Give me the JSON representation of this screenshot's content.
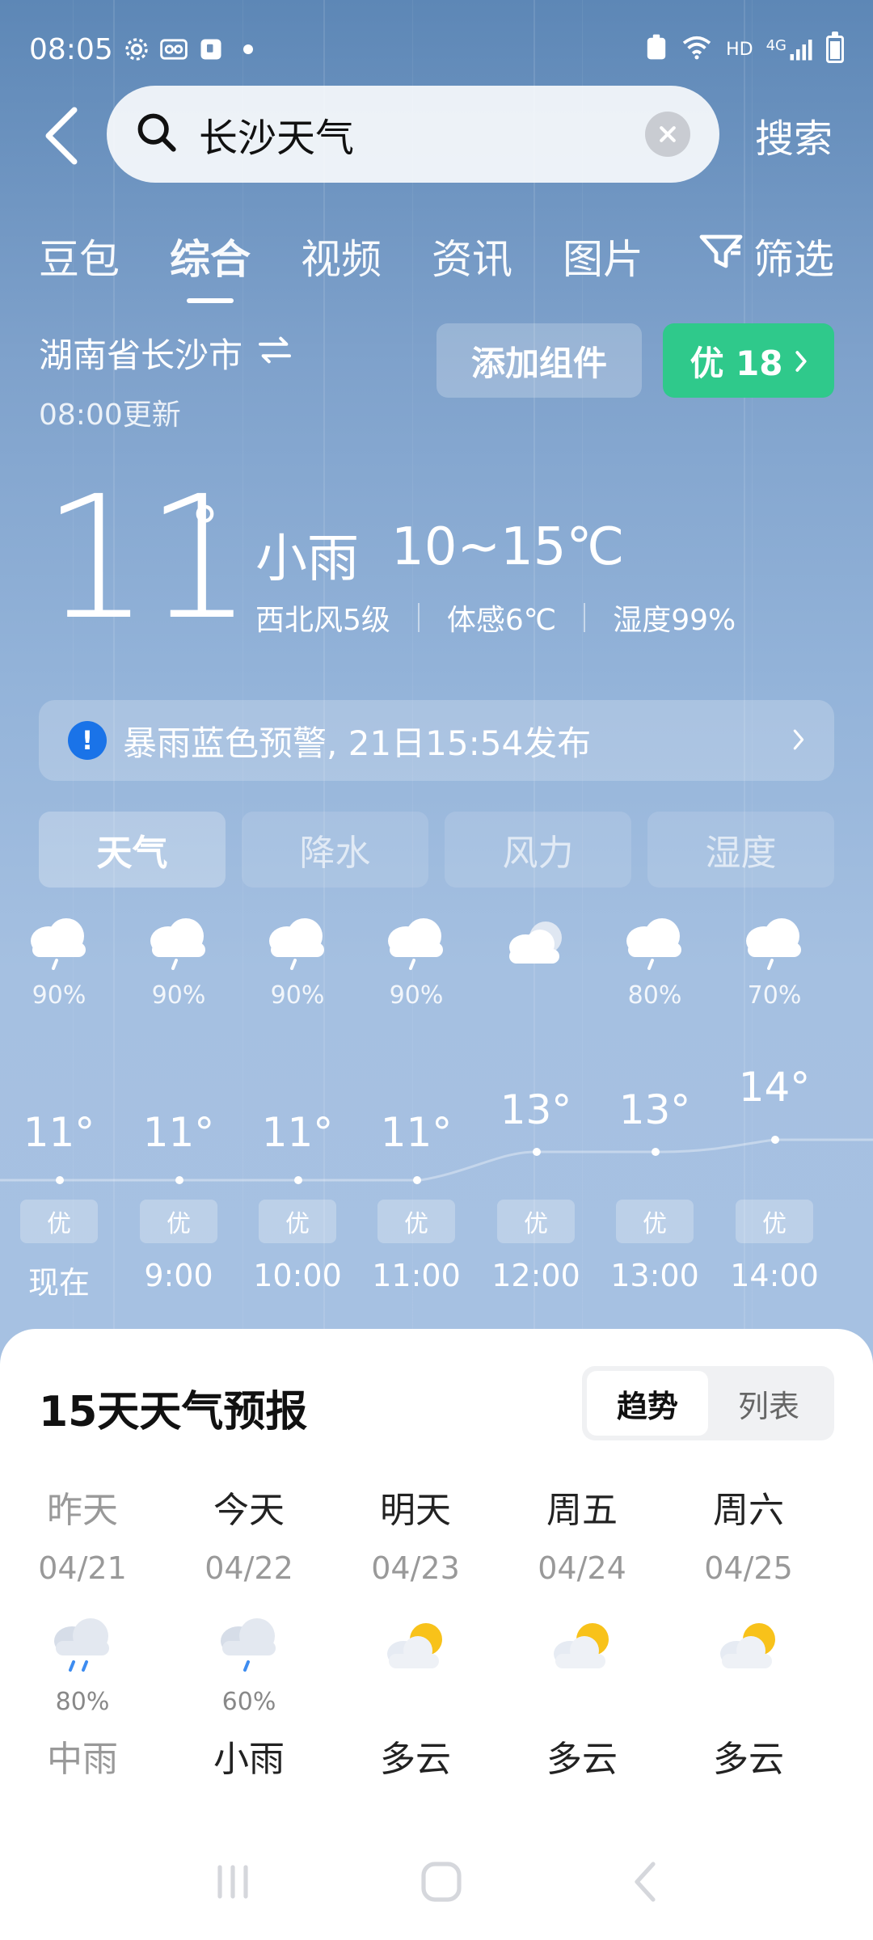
{
  "status": {
    "time": "08:05",
    "network": "HD",
    "signal": "4G"
  },
  "search": {
    "query": "长沙天气",
    "button": "搜索"
  },
  "tabs": [
    "豆包",
    "综合",
    "视频",
    "资讯",
    "图片"
  ],
  "filter_label": "筛选",
  "location": {
    "name": "湖南省长沙市",
    "updated": "08:00更新"
  },
  "actions": {
    "add_widget": "添加组件",
    "aqi": "优 18"
  },
  "current": {
    "temp": "11",
    "deg": "°",
    "condition": "小雨",
    "range": "10~15℃",
    "wind": "西北风5级",
    "feels": "体感6℃",
    "humidity": "湿度99%"
  },
  "warning": {
    "text": "暴雨蓝色预警, 21日15:54发布"
  },
  "metric_tabs": [
    "天气",
    "降水",
    "风力",
    "湿度"
  ],
  "hourly": [
    {
      "label": "现在",
      "temp": "11°",
      "prob": "90%",
      "aq": "优",
      "icon": "rain-cloud-icon"
    },
    {
      "label": "9:00",
      "temp": "11°",
      "prob": "90%",
      "aq": "优",
      "icon": "rain-cloud-icon"
    },
    {
      "label": "10:00",
      "temp": "11°",
      "prob": "90%",
      "aq": "优",
      "icon": "rain-cloud-icon"
    },
    {
      "label": "11:00",
      "temp": "11°",
      "prob": "90%",
      "aq": "优",
      "icon": "rain-cloud-icon"
    },
    {
      "label": "12:00",
      "temp": "13°",
      "prob": "",
      "aq": "优",
      "icon": "cloudy-icon"
    },
    {
      "label": "13:00",
      "temp": "13°",
      "prob": "80%",
      "aq": "优",
      "icon": "rain-cloud-icon"
    },
    {
      "label": "14:00",
      "temp": "14°",
      "prob": "70%",
      "aq": "优",
      "icon": "rain-cloud-icon"
    }
  ],
  "forecast": {
    "title": "15天天气预报",
    "toggle": [
      "趋势",
      "列表"
    ],
    "days": [
      {
        "name": "昨天",
        "date": "04/21",
        "prob": "80%",
        "cond": "中雨",
        "icon": "moderate-rain-icon"
      },
      {
        "name": "今天",
        "date": "04/22",
        "prob": "60%",
        "cond": "小雨",
        "icon": "light-rain-icon"
      },
      {
        "name": "明天",
        "date": "04/23",
        "prob": "",
        "cond": "多云",
        "icon": "partly-cloudy-icon"
      },
      {
        "name": "周五",
        "date": "04/24",
        "prob": "",
        "cond": "多云",
        "icon": "partly-cloudy-icon"
      },
      {
        "name": "周六",
        "date": "04/25",
        "prob": "",
        "cond": "多云",
        "icon": "partly-cloudy-icon"
      }
    ]
  }
}
